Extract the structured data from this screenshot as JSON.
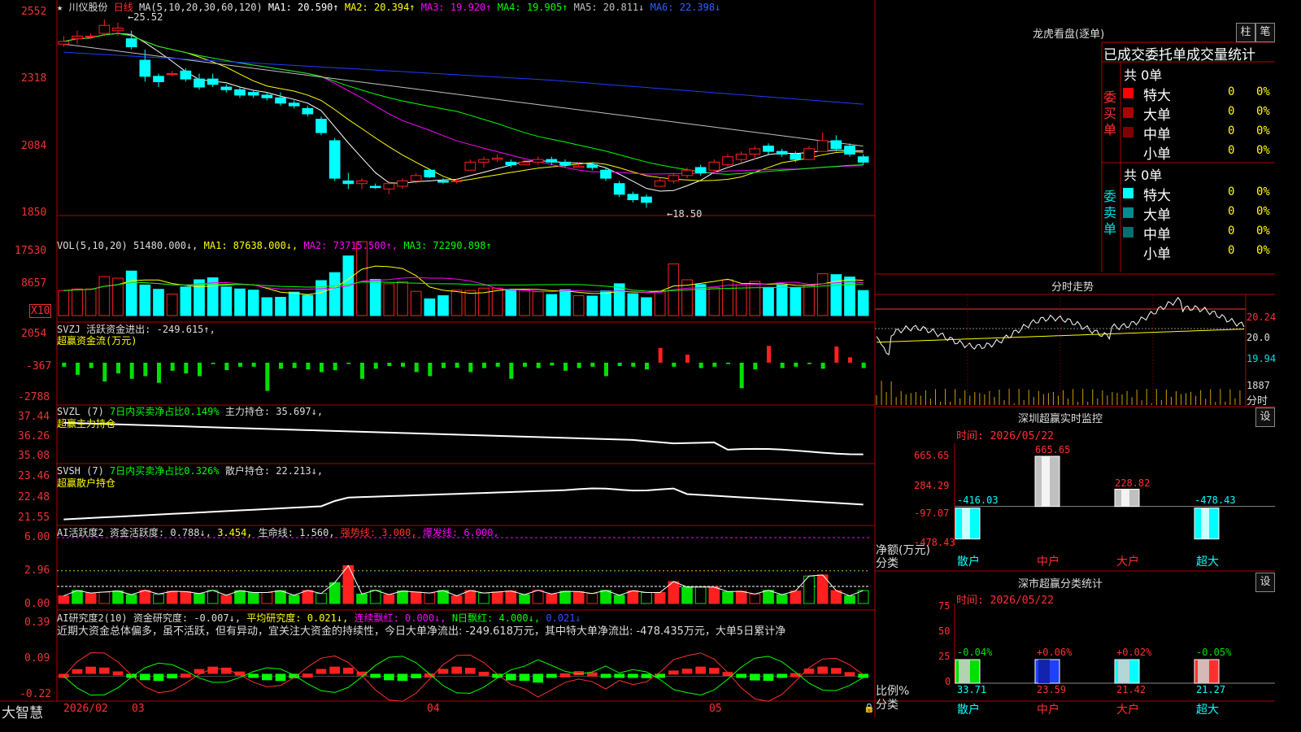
{
  "stock": {
    "star": "★",
    "name": "川仪股份",
    "period": "日线",
    "ma_label": "MA(5,10,20,30,60,120)"
  },
  "ma": [
    {
      "text": "MA1: 20.590↑",
      "color": "#ffffff"
    },
    {
      "text": "MA2: 20.394↑",
      "color": "#ffff00"
    },
    {
      "text": "MA3: 19.920↑",
      "color": "#ff00ff"
    },
    {
      "text": "MA4: 19.905↑",
      "color": "#00ff00"
    },
    {
      "text": "MA5: 20.811↓",
      "color": "#c0c0c0"
    },
    {
      "text": "MA6: 22.398↓",
      "color": "#0000ff"
    }
  ],
  "price_axis": [
    "2552",
    "2318",
    "2084",
    "1850"
  ],
  "price_marks": {
    "high": "25.52",
    "low": "18.50"
  },
  "vol_panel": {
    "label": "VOL(5,10,20)",
    "value": "51480.000↓,",
    "ma": [
      {
        "text": "MA1: 87638.000↓,",
        "color": "#ffff00"
      },
      {
        "text": "MA2: 73715.500↑,",
        "color": "#ff00ff"
      },
      {
        "text": "MA3: 72290.898↑",
        "color": "#00ff00"
      }
    ],
    "axis": [
      "17530",
      "8657"
    ],
    "unit": "X10"
  },
  "svzj_panel": {
    "label": "SVZJ",
    "title": "活跃资金进出: -249.615↑,",
    "subtitle": "超赢资金流(万元)",
    "axis": [
      "2054",
      "-367",
      "-2788"
    ]
  },
  "svzl_panel": {
    "label": "SVZL (7)",
    "net": "7日内买卖净占比0.149%",
    "hold": "主力持仓: 35.697↓,",
    "subtitle": "超赢主力持仓",
    "axis": [
      "37.44",
      "36.26",
      "35.08"
    ]
  },
  "svsh_panel": {
    "label": "SVSH (7)",
    "net": "7日内买卖净占比0.326%",
    "hold": "散户持仓: 22.213↓,",
    "subtitle": "超赢散户持仓",
    "axis": [
      "23.46",
      "22.48",
      "21.55"
    ]
  },
  "ai_active": {
    "label": "AI活跃度2",
    "v1": "资金活跃度: 0.788↓,",
    "v2": "3.454,",
    "v3": "生命线: 1.560,",
    "v4": "强势线: 3.000,",
    "v5": "爆发线: 6.000,",
    "axis": [
      "6.00",
      "2.96",
      "0.00"
    ]
  },
  "ai_research": {
    "label": "AI研究度2(10)",
    "v1": "资金研究度: -0.007↓,",
    "v2": "平均研究度: 0.021↓,",
    "v3": "连续飘红: 0.000↓,",
    "v4": "N日飘红: 4.000↓,",
    "v5": "0.021↓",
    "note": "近期大资金总体偏多，虽不活跃，但有异动，宜关注大资金的持续性，今日大单净流出: -249.618万元，其中特大单净流出: -478.435万元，大单5日累计净",
    "axis": [
      "0.39",
      "0.09",
      "-0.22"
    ]
  },
  "bottom_bar": {
    "app": "大智慧",
    "dates": [
      "2026/02",
      "03",
      "04",
      "05"
    ]
  },
  "right": {
    "dragon_title": "龙虎看盘(逐单)",
    "btn_zhu": "柱",
    "btn_bi": "笔",
    "order_header": "已成交委托单成交量统计",
    "buy_side": "委买单",
    "sell_side": "委卖单",
    "buy_total": "共 0单",
    "sell_total": "共 0单",
    "buy_rows": [
      {
        "label": "特大",
        "n": "0",
        "pct": "0%",
        "color": "#ff0000"
      },
      {
        "label": "大单",
        "n": "0",
        "pct": "0%",
        "color": "#b00000"
      },
      {
        "label": "中单",
        "n": "0",
        "pct": "0%",
        "color": "#800000"
      },
      {
        "label": "小单",
        "n": "0",
        "pct": "0%",
        "color": "#000000"
      }
    ],
    "sell_rows": [
      {
        "label": "特大",
        "n": "0",
        "pct": "0%",
        "color": "#00ffff"
      },
      {
        "label": "大单",
        "n": "0",
        "pct": "0%",
        "color": "#008c8c"
      },
      {
        "label": "中单",
        "n": "0",
        "pct": "0%",
        "color": "#007070"
      },
      {
        "label": "小单",
        "n": "0",
        "pct": "0%",
        "color": "#000000"
      }
    ],
    "intraday_title": "分时走势",
    "intraday_axis": [
      "20.24",
      "20.0",
      "19.94"
    ],
    "intraday_vol": "1887",
    "intraday_vol_label": "分时",
    "sz_monitor_title": "深圳超赢实时监控",
    "sz_monitor_btn": "设",
    "sz_monitor_time": "时间: 2026/05/22",
    "sz_monitor_axis": [
      "665.65",
      "284.29",
      "-97.07",
      "-478.43"
    ],
    "sz_monitor_ylabel": "净额(万元)",
    "sz_monitor_xlabel": "分类",
    "sz_monitor_cats": [
      "散户",
      "中户",
      "大户",
      "超大"
    ],
    "sz_monitor_vals": [
      "-416.03",
      "665.65",
      "228.82",
      "-478.43"
    ],
    "class_title": "深市超赢分类统计",
    "class_btn": "设",
    "class_time": "时间: 2026/05/22",
    "class_axis": [
      "75",
      "50",
      "25",
      "0"
    ],
    "class_ylabel": "比例%",
    "class_xlabel": "分类",
    "class_cats": [
      "散户",
      "中户",
      "大户",
      "超大"
    ],
    "class_vals": [
      "33.71",
      "23.59",
      "21.42",
      "21.27"
    ],
    "class_changes": [
      "-0.04%",
      "+0.06%",
      "+0.02%",
      "-0.05%"
    ]
  },
  "chart_data": [
    {
      "type": "candlestick",
      "title": "川仪股份 日线",
      "x": [
        "2026/02",
        "03",
        "04",
        "05"
      ],
      "ylim": [
        18.5,
        25.52
      ],
      "ohlc": [
        [
          24.6,
          24.9,
          24.5,
          24.7
        ],
        [
          24.8,
          25.1,
          24.6,
          24.9
        ],
        [
          24.9,
          25.0,
          24.8,
          24.9
        ],
        [
          25.0,
          25.52,
          24.9,
          25.3
        ],
        [
          25.1,
          25.4,
          24.9,
          25.2
        ],
        [
          24.8,
          25.1,
          24.4,
          24.5
        ],
        [
          24.0,
          24.4,
          23.2,
          23.4
        ],
        [
          23.4,
          23.5,
          23.0,
          23.2
        ],
        [
          23.5,
          23.6,
          23.4,
          23.5
        ],
        [
          23.6,
          23.7,
          23.2,
          23.3
        ],
        [
          23.3,
          23.5,
          22.9,
          23.0
        ],
        [
          23.3,
          23.5,
          23.0,
          23.1
        ],
        [
          23.0,
          23.1,
          22.8,
          22.9
        ],
        [
          22.9,
          23.0,
          22.6,
          22.7
        ],
        [
          22.8,
          22.9,
          22.6,
          22.7
        ],
        [
          22.7,
          22.8,
          22.5,
          22.6
        ],
        [
          22.6,
          22.8,
          22.3,
          22.4
        ],
        [
          22.4,
          22.5,
          22.2,
          22.3
        ],
        [
          22.2,
          22.3,
          21.9,
          22.0
        ],
        [
          21.8,
          21.9,
          21.2,
          21.3
        ],
        [
          21.0,
          21.1,
          19.5,
          19.6
        ],
        [
          19.5,
          19.8,
          19.2,
          19.4
        ],
        [
          19.4,
          19.6,
          19.2,
          19.5
        ],
        [
          19.3,
          19.4,
          19.2,
          19.25
        ],
        [
          19.2,
          19.5,
          19.0,
          19.4
        ],
        [
          19.3,
          19.6,
          19.2,
          19.5
        ],
        [
          19.5,
          19.8,
          19.4,
          19.7
        ],
        [
          19.9,
          19.95,
          19.6,
          19.65
        ],
        [
          19.5,
          19.6,
          19.4,
          19.45
        ],
        [
          19.5,
          19.6,
          19.4,
          19.5
        ],
        [
          19.9,
          20.3,
          19.9,
          20.2
        ],
        [
          20.2,
          20.4,
          20.0,
          20.3
        ],
        [
          20.3,
          20.5,
          20.2,
          20.35
        ],
        [
          20.2,
          20.3,
          20.0,
          20.1
        ],
        [
          20.1,
          20.3,
          20.1,
          20.2
        ],
        [
          20.2,
          20.4,
          20.1,
          20.3
        ],
        [
          20.3,
          20.4,
          20.1,
          20.2
        ],
        [
          20.2,
          20.3,
          20.0,
          20.1
        ],
        [
          20.0,
          20.2,
          20.0,
          20.05
        ],
        [
          20.1,
          20.2,
          19.9,
          20.0
        ],
        [
          19.9,
          20.0,
          19.5,
          19.6
        ],
        [
          19.4,
          19.5,
          18.9,
          19.0
        ],
        [
          19.0,
          19.1,
          18.7,
          18.8
        ],
        [
          18.9,
          19.0,
          18.5,
          18.7
        ],
        [
          19.3,
          19.6,
          19.3,
          19.5
        ],
        [
          19.5,
          19.8,
          19.4,
          19.7
        ],
        [
          19.7,
          20.0,
          19.6,
          19.9
        ],
        [
          20.0,
          20.1,
          19.7,
          19.8
        ],
        [
          19.9,
          20.3,
          19.8,
          20.2
        ],
        [
          20.1,
          20.5,
          20.0,
          20.4
        ],
        [
          20.3,
          20.6,
          20.2,
          20.5
        ],
        [
          20.5,
          20.8,
          20.3,
          20.7
        ],
        [
          20.8,
          20.9,
          20.5,
          20.6
        ],
        [
          20.6,
          20.7,
          20.4,
          20.5
        ],
        [
          20.5,
          20.6,
          20.2,
          20.3
        ],
        [
          20.3,
          20.8,
          20.3,
          20.7
        ],
        [
          20.6,
          21.3,
          20.6,
          21.0
        ],
        [
          21.0,
          21.2,
          20.6,
          20.7
        ],
        [
          20.8,
          20.9,
          20.4,
          20.5
        ],
        [
          20.4,
          20.5,
          20.1,
          20.2
        ]
      ],
      "ma_series": [
        {
          "name": "MA1",
          "last": 20.59,
          "color": "#ffffff"
        },
        {
          "name": "MA2",
          "last": 20.394,
          "color": "#ffff00"
        },
        {
          "name": "MA3",
          "last": 19.92,
          "color": "#ff00ff"
        },
        {
          "name": "MA4",
          "last": 19.905,
          "color": "#00ff00"
        },
        {
          "name": "MA5",
          "last": 20.811,
          "color": "#c0c0c0"
        },
        {
          "name": "MA6",
          "last": 22.398,
          "color": "#0000ff"
        }
      ]
    },
    {
      "type": "bar",
      "title": "VOL(5,10,20)",
      "values_x10": [
        6300,
        6700,
        6700,
        9800,
        9400,
        11200,
        7700,
        6600,
        5400,
        7200,
        9000,
        9500,
        7200,
        6700,
        6400,
        4500,
        4600,
        5900,
        5100,
        8800,
        10800,
        15000,
        18600,
        9100,
        8000,
        8500,
        6100,
        4200,
        5000,
        6400,
        6300,
        6900,
        6900,
        6600,
        6500,
        6000,
        5300,
        6500,
        5000,
        4900,
        6200,
        8000,
        5500,
        4500,
        6200,
        13000,
        9000,
        7800,
        7000,
        9000,
        7700,
        8600,
        7100,
        7700,
        7000,
        7600,
        10500,
        10300,
        9700,
        6300
      ],
      "ylim": [
        0,
        17530
      ]
    },
    {
      "type": "bar",
      "title": "SVZJ 活跃资金进出",
      "values": [
        -300,
        -900,
        -400,
        -1400,
        -800,
        -1200,
        -1000,
        -1500,
        -600,
        -800,
        -1000,
        -100,
        -550,
        -300,
        -300,
        -2100,
        -450,
        -400,
        -500,
        -700,
        -560,
        -100,
        -1200,
        -450,
        -250,
        -300,
        -700,
        -1000,
        -400,
        -380,
        -700,
        -400,
        -300,
        -1200,
        -300,
        -400,
        -200,
        -600,
        -400,
        -300,
        -1000,
        -250,
        -300,
        -500,
        1100,
        -300,
        600,
        -400,
        -300,
        -100,
        -1900,
        -500,
        1250,
        -400,
        -300,
        -100,
        -450,
        1200,
        400,
        -400
      ]
    },
    {
      "type": "line",
      "title": "SVZL 主力持仓",
      "ylim": [
        35.08,
        37.44
      ],
      "last": 35.697
    },
    {
      "type": "line",
      "title": "SVSH 散户持仓",
      "ylim": [
        21.55,
        23.46
      ],
      "last": 22.213
    },
    {
      "type": "bar",
      "title": "AI活跃度2",
      "ylim": [
        0,
        6.0
      ]
    },
    {
      "type": "bar",
      "title": "AI研究度2(10)",
      "ylim": [
        -0.22,
        0.39
      ]
    },
    {
      "type": "bar",
      "title": "深圳超赢实时监控",
      "categories": [
        "散户",
        "中户",
        "大户",
        "超大"
      ],
      "values": [
        -416.03,
        665.65,
        228.82,
        -478.43
      ],
      "ylabel": "净额(万元)",
      "ylim": [
        -478.43,
        665.65
      ]
    },
    {
      "type": "bar",
      "title": "深市超赢分类统计",
      "categories": [
        "散户",
        "中户",
        "大户",
        "超大"
      ],
      "values": [
        33.71,
        23.59,
        21.42,
        21.27
      ],
      "ylabel": "比例%",
      "ylim": [
        0,
        75
      ]
    }
  ]
}
